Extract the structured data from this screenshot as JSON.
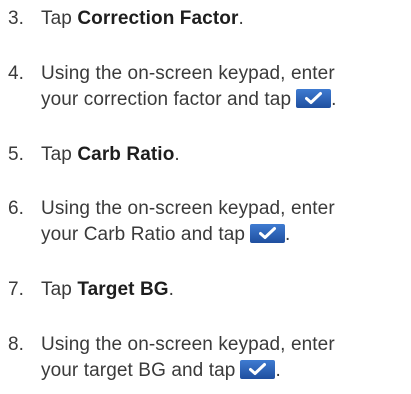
{
  "steps": [
    {
      "number": "3.",
      "prefix": "Tap ",
      "bold": "Correction Factor",
      "suffix": "."
    },
    {
      "number": "4.",
      "line1": "Using the on-screen keypad, enter",
      "line2": "your correction factor and tap",
      "end": ".",
      "icon": "checkmark-button-icon"
    },
    {
      "number": "5.",
      "prefix": "Tap ",
      "bold": "Carb Ratio",
      "suffix": "."
    },
    {
      "number": "6.",
      "line1": "Using the on-screen keypad, enter",
      "line2": "your Carb Ratio and tap",
      "end": ".",
      "icon": "checkmark-button-icon"
    },
    {
      "number": "7.",
      "prefix": "Tap ",
      "bold": "Target BG",
      "suffix": "."
    },
    {
      "number": "8.",
      "line1": "Using the on-screen keypad, enter",
      "line2": "your target BG and tap",
      "end": ".",
      "icon": "checkmark-button-icon"
    }
  ],
  "colors": {
    "text": "#3a3a3a",
    "button": "#2a5fb8",
    "check": "#ffffff"
  }
}
